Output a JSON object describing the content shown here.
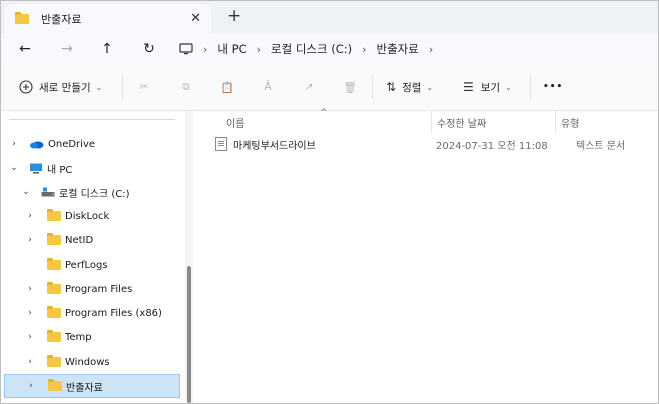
{
  "tab": {
    "title": "반출자료",
    "close": "✕",
    "new_tab": "+"
  },
  "nav": {
    "back": "←",
    "forward": "→",
    "up": "↑",
    "refresh": "↻",
    "breadcrumbs": [
      "내 PC",
      "로컬 디스크 (C:)",
      "반출자료"
    ]
  },
  "toolbar": {
    "new_label": "새로 만들기",
    "sort_label": "정렬",
    "view_label": "보기",
    "more": "•••"
  },
  "sidebar": {
    "items": [
      {
        "label": "OneDrive",
        "icon": "onedrive-icon",
        "chevron": "›"
      },
      {
        "label": "내 PC",
        "icon": "pc-icon",
        "chevron": "⌄"
      },
      {
        "label": "로컬 디스크 (C:)",
        "icon": "drive-icon",
        "chevron": "⌄"
      },
      {
        "label": "DiskLock",
        "icon": "folder-icon",
        "chevron": "›"
      },
      {
        "label": "NetID",
        "icon": "folder-icon",
        "chevron": "›"
      },
      {
        "label": "PerfLogs",
        "icon": "folder-icon",
        "chevron": ""
      },
      {
        "label": "Program Files",
        "icon": "folder-icon",
        "chevron": "›"
      },
      {
        "label": "Program Files (x86)",
        "icon": "folder-icon",
        "chevron": "›"
      },
      {
        "label": "Temp",
        "icon": "folder-icon",
        "chevron": "›"
      },
      {
        "label": "Windows",
        "icon": "folder-icon",
        "chevron": "›"
      },
      {
        "label": "반출자료",
        "icon": "folder-icon",
        "chevron": "›",
        "selected": true
      }
    ]
  },
  "columns": {
    "name": "이름",
    "modified": "수정한 날짜",
    "type": "유형"
  },
  "files": [
    {
      "name": "마케팅부서드라이브",
      "modified": "2024-07-31 오전 11:08",
      "type": "텍스트 문서"
    }
  ],
  "colors": {
    "accent": "#0067c0",
    "folder": "#f4c842",
    "selection": "#cde4f7"
  }
}
